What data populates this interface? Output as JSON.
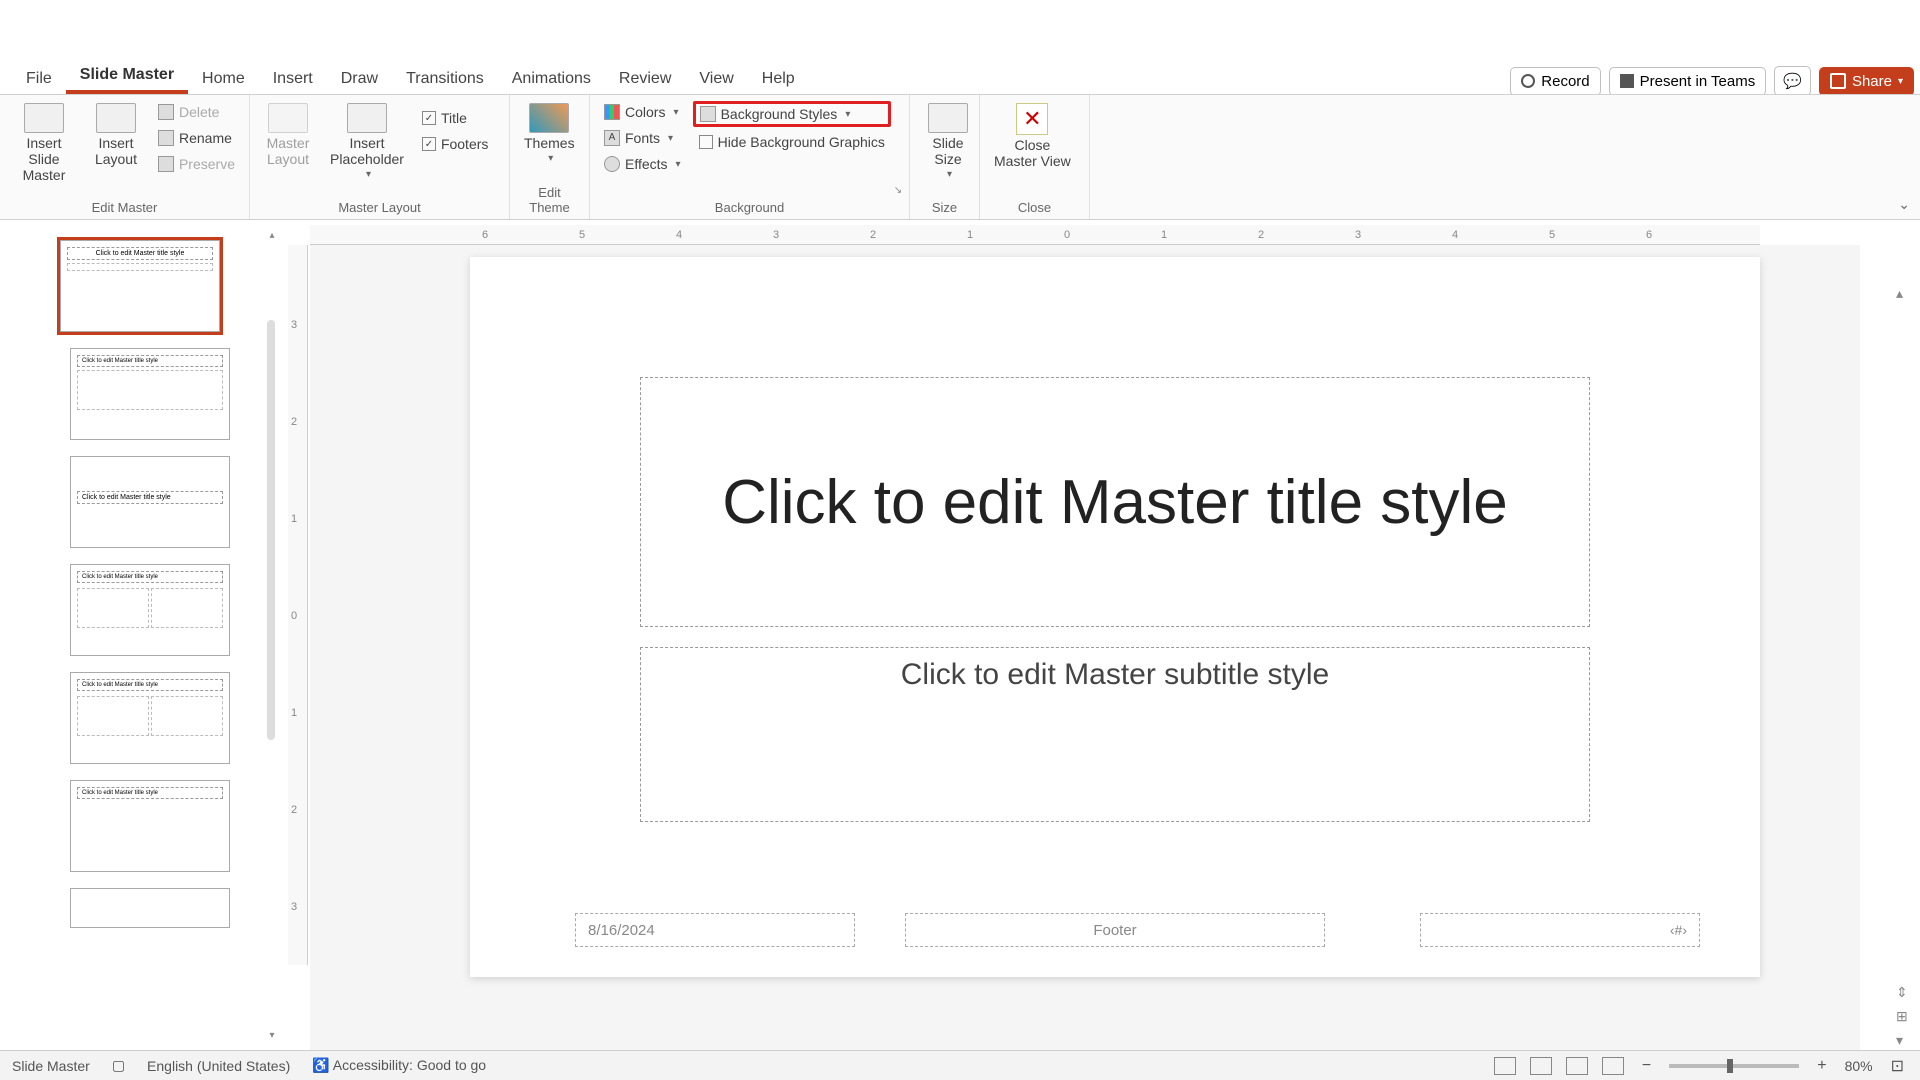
{
  "titlebar": {
    "record": "Record",
    "present_teams": "Present in Teams",
    "share": "Share"
  },
  "tabs": [
    "File",
    "Slide Master",
    "Home",
    "Insert",
    "Draw",
    "Transitions",
    "Animations",
    "Review",
    "View",
    "Help"
  ],
  "active_tab_index": 1,
  "ribbon": {
    "groups": {
      "edit_master": {
        "label": "Edit Master",
        "insert_slide_master": "Insert Slide\nMaster",
        "insert_layout": "Insert\nLayout",
        "delete": "Delete",
        "rename": "Rename",
        "preserve": "Preserve"
      },
      "master_layout": {
        "label": "Master Layout",
        "master_layout_btn": "Master\nLayout",
        "insert_placeholder": "Insert\nPlaceholder",
        "title_chk": "Title",
        "footers_chk": "Footers"
      },
      "edit_theme": {
        "label": "Edit Theme",
        "themes": "Themes"
      },
      "background": {
        "label": "Background",
        "colors": "Colors",
        "fonts": "Fonts",
        "effects": "Effects",
        "background_styles": "Background Styles",
        "hide_bg": "Hide Background Graphics"
      },
      "size": {
        "label": "Size",
        "slide_size": "Slide\nSize"
      },
      "close": {
        "label": "Close",
        "close_master": "Close\nMaster View"
      }
    }
  },
  "ruler_ticks": [
    "6",
    "5",
    "4",
    "3",
    "2",
    "1",
    "0",
    "1",
    "2",
    "3",
    "4",
    "5",
    "6"
  ],
  "ruler_v_ticks": [
    "3",
    "2",
    "1",
    "0",
    "1",
    "2",
    "3"
  ],
  "thumbs": {
    "master_title": "Click to edit Master title style",
    "layout_title": "Click to edit Master title style"
  },
  "slide": {
    "title_placeholder": "Click to edit Master title style",
    "subtitle_placeholder": "Click to edit Master subtitle style",
    "date": "8/16/2024",
    "footer": "Footer",
    "slidenum": "‹#›"
  },
  "statusbar": {
    "view_name": "Slide Master",
    "language": "English (United States)",
    "accessibility": "Accessibility: Good to go",
    "zoom": "80%"
  }
}
